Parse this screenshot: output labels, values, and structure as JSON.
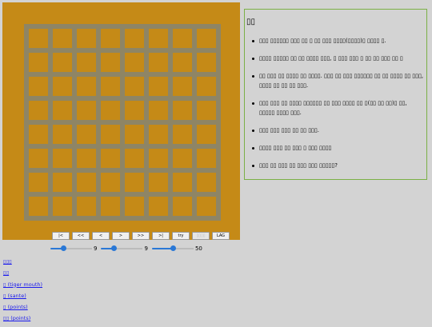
{
  "board": {
    "rows": 8,
    "cols": 8
  },
  "controls": {
    "first": "|<",
    "back_fast": "<<",
    "back": "<",
    "forward": ">",
    "forward_fast": ">>",
    "last": ">|",
    "try": "try",
    "disabled_button": "▯▯▯▯",
    "lag": "LAG"
  },
  "sliders": [
    {
      "value": "9",
      "level": 0.3
    },
    {
      "value": "9",
      "level": 0.3
    },
    {
      "value": "50",
      "level": 0.5
    }
  ],
  "links": [
    "▯▯▯",
    "▯▯",
    "▯ (tiger mouth)",
    "▯ (sante)",
    "▯ (points)",
    "▯▯ (points)"
  ],
  "help": {
    "title": "▯▯",
    "items": [
      "▯▯▯ ▯▯▯▯▯▯ ▯▯▯ ▯▯ ▯ ▯▯ ▯▯▯ ▯▯▯▯(▯▯▯▯)▯ ▯▯▯▯ ▯.",
      "▯▯▯▯ ▯▯▯▯▯ ▯▯ ▯▯ ▯▯▯▯ ▯▯▯, ▯ ▯▯▯ ▯▯▯ ▯ ▯▯ ▯▯ ▯▯▯ ▯▯ ▯",
      "▯▯ ▯▯▯ ▯▯ ▯▯▯▯ ▯▯ ▯▯▯▯. ▯▯▯ ▯▯ ▯▯▯ ▯▯▯▯▯▯ ▯▯ ▯▯ ▯▯▯▯ ▯▯ ▯▯▯, ▯▯▯▯ ▯▯ ▯▯ ▯▯ ▯▯▯.",
      "▯▯▯ ▯▯▯ ▯▯ ▯▯▯▯ ▯▯▯▯▯▯ ▯▯ ▯▯▯ ▯▯▯▯ ▯▯ ▯(▯▯ ▯▯ ▯▯)▯ ▯▯, ▯▯▯▯▯ ▯▯▯▯ ▯▯▯.",
      "▯▯▯ ▯▯▯ ▯▯▯ ▯▯ ▯▯ ▯▯▯.",
      "▯▯▯▯ ▯▯▯ ▯▯ ▯▯▯ ▯ ▯▯▯ ▯▯▯▯",
      "▯▯▯ ▯▯ ▯▯▯ ▯▯ ▯▯▯ ▯▯▯ ▯▯▯▯▯?"
    ]
  },
  "colors": {
    "board_bg": "#c58a17",
    "grid_line": "#8e8565",
    "panel_border": "#7bb046",
    "link": "#1a1aee",
    "slider": "#2a78d6"
  }
}
